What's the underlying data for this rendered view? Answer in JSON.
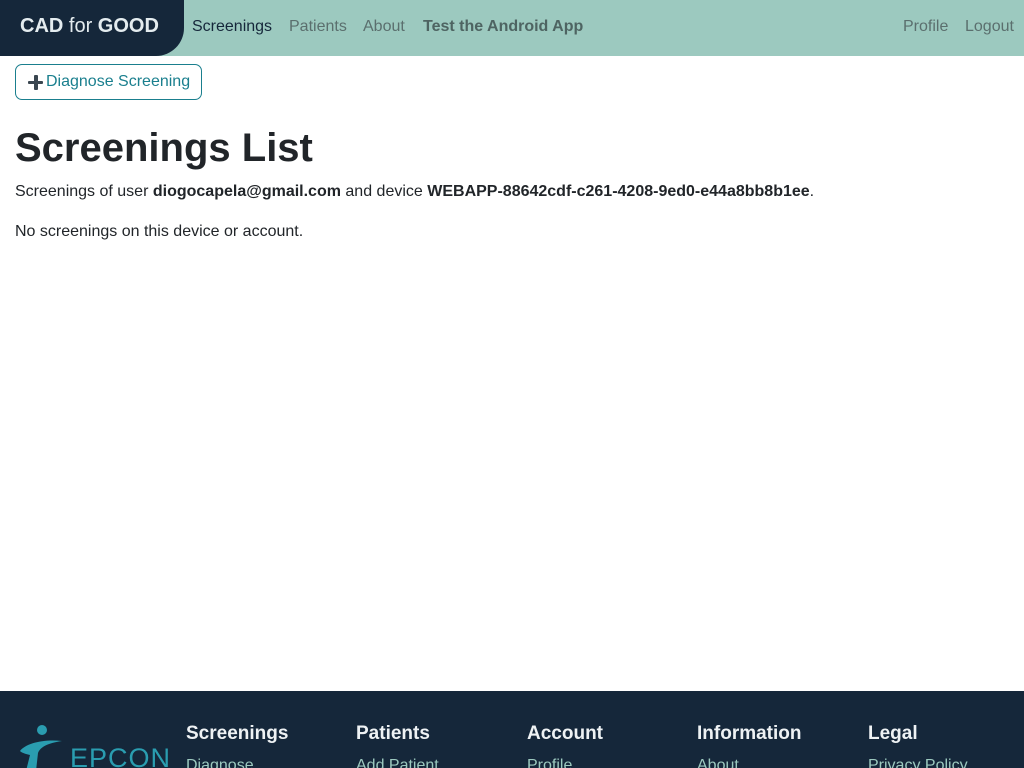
{
  "navbar": {
    "brand_strong1": "CAD",
    "brand_light": " for ",
    "brand_strong2": "GOOD",
    "links": {
      "screenings": "Screenings",
      "patients": "Patients",
      "about": "About",
      "android": "Test the Android App",
      "profile": "Profile",
      "logout": "Logout"
    }
  },
  "actions": {
    "diagnose_label": "Diagnose Screening"
  },
  "main": {
    "title": "Screenings List",
    "subtitle_prefix": "Screenings of user ",
    "user_email": "diogocapela@gmail.com",
    "subtitle_middle": " and device ",
    "device_id": "WEBAPP-88642cdf-c261-4208-9ed0-e44a8bb8b1ee",
    "subtitle_suffix": ".",
    "empty_message": "No screenings on this device or account."
  },
  "footer": {
    "logo_text": "EPCON",
    "columns": {
      "screenings": {
        "heading": "Screenings",
        "first_link": "Diagnose"
      },
      "patients": {
        "heading": "Patients",
        "first_link": "Add Patient"
      },
      "account": {
        "heading": "Account",
        "first_link": "Profile"
      },
      "information": {
        "heading": "Information",
        "first_link": "About"
      },
      "legal": {
        "heading": "Legal",
        "first_link": "Privacy Policy"
      }
    }
  },
  "colors": {
    "navbar_bg": "#9cc9bf",
    "brand_bg": "#15273a",
    "accent": "#1a7f8e",
    "footer_bg": "#15273a"
  }
}
